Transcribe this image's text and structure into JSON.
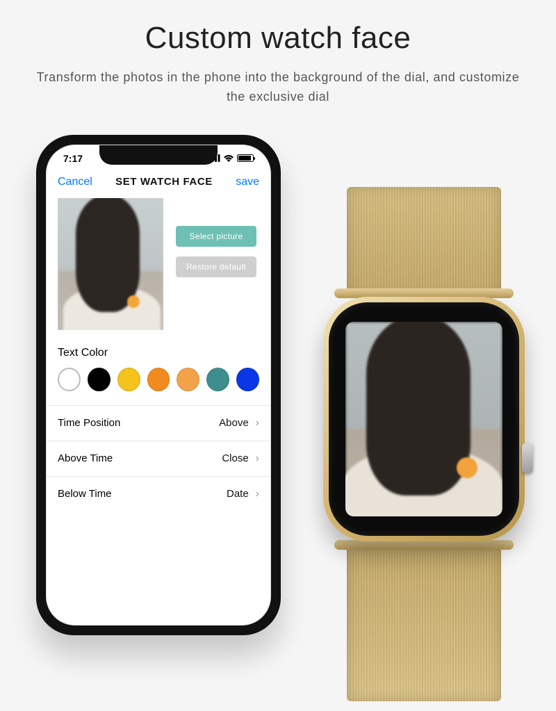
{
  "hero": {
    "title": "Custom watch face",
    "subtitle": "Transform the photos in the phone into the background of the dial, and customize the exclusive dial"
  },
  "phone": {
    "status": {
      "time": "7:17"
    },
    "nav": {
      "cancel": "Cancel",
      "title": "SET WATCH FACE",
      "save": "save"
    },
    "buttons": {
      "select": "Select picture",
      "restore": "Restore default"
    },
    "text_color_label": "Text Color",
    "colors": [
      {
        "name": "white",
        "hex": "#ffffff",
        "selected": true
      },
      {
        "name": "black",
        "hex": "#000000",
        "selected": false
      },
      {
        "name": "yellow",
        "hex": "#f6c21c",
        "selected": false
      },
      {
        "name": "orange",
        "hex": "#f28b1f",
        "selected": false
      },
      {
        "name": "amber",
        "hex": "#f4a24a",
        "selected": false
      },
      {
        "name": "teal",
        "hex": "#3f8e8e",
        "selected": false
      },
      {
        "name": "blue",
        "hex": "#0b36e5",
        "selected": false
      }
    ],
    "settings": [
      {
        "label": "Time Position",
        "value": "Above"
      },
      {
        "label": "Above Time",
        "value": "Close"
      },
      {
        "label": "Below Time",
        "value": "Date"
      }
    ]
  }
}
